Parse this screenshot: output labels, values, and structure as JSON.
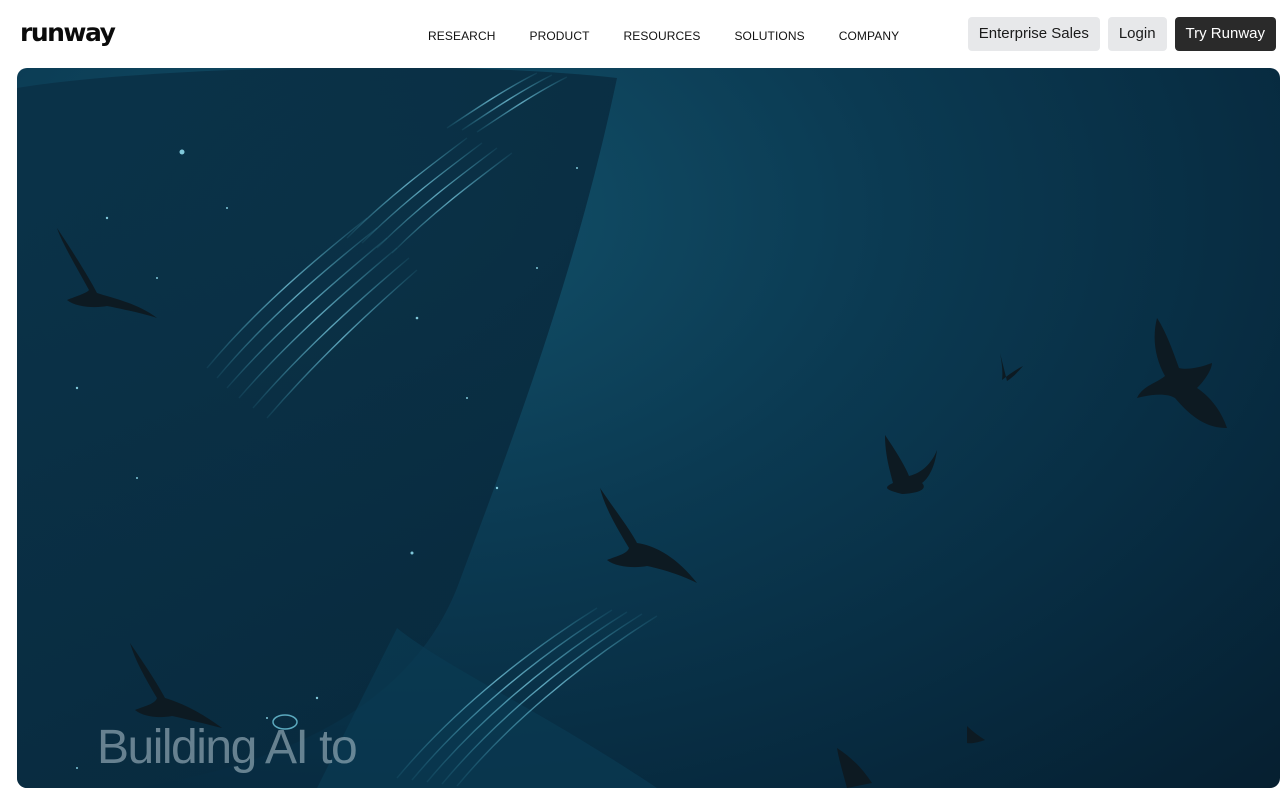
{
  "header": {
    "logo": "runway",
    "nav": [
      "RESEARCH",
      "PRODUCT",
      "RESOURCES",
      "SOLUTIONS",
      "COMPANY"
    ],
    "buttons": {
      "enterprise": "Enterprise Sales",
      "login": "Login",
      "try": "Try Runway"
    }
  },
  "hero": {
    "headline": "Building AI to"
  },
  "colors": {
    "button_light": "#e7e8ea",
    "button_dark": "#2a2a2a",
    "hero_water": "#0b3a52"
  }
}
